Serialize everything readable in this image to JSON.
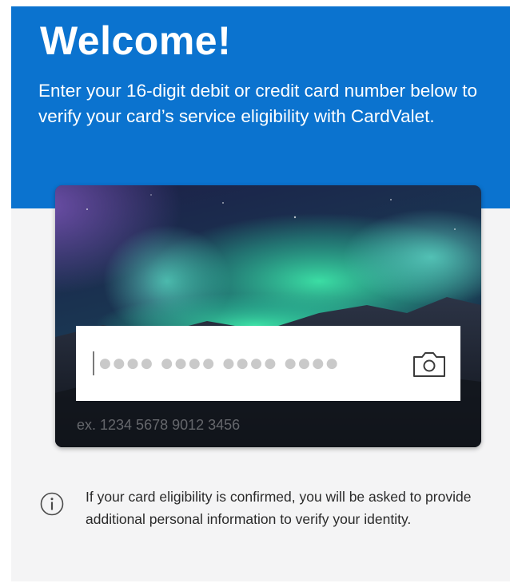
{
  "header": {
    "title": "Welcome!",
    "description": "Enter your 16-digit debit or credit card number below to verify your card’s service eligibility with CardValet."
  },
  "card_entry": {
    "masked_placeholder": "●●●● ●●●● ●●●● ●●●●",
    "example_hint": "ex. 1234 5678 9012 3456",
    "scan_icon": "camera-icon"
  },
  "notice": {
    "icon": "info-icon",
    "text": "If your card eligibility is confirmed, you will be asked to provide additional personal information to verify your identity."
  },
  "colors": {
    "header_blue": "#0b73cf",
    "page_background": "#f4f4f5",
    "aurora_green": "#3de6a8"
  }
}
